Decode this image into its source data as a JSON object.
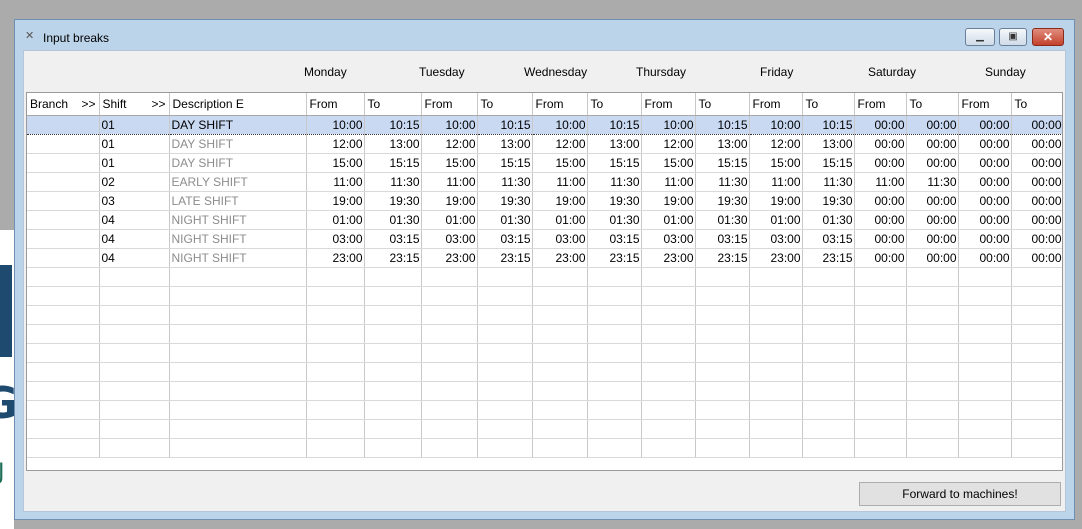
{
  "window": {
    "title": "Input breaks"
  },
  "days": [
    "Monday",
    "Tuesday",
    "Wednesday",
    "Thursday",
    "Friday",
    "Saturday",
    "Sunday"
  ],
  "columns": {
    "branch": "Branch",
    "branch_arrow": ">>",
    "shift": "Shift",
    "shift_arrow": ">>",
    "description": "Description E",
    "from": "From",
    "to": "To"
  },
  "rows": [
    {
      "branch": "",
      "shift": "01",
      "description": "DAY SHIFT",
      "times": [
        "10:00",
        "10:15",
        "10:00",
        "10:15",
        "10:00",
        "10:15",
        "10:00",
        "10:15",
        "10:00",
        "10:15",
        "00:00",
        "00:00",
        "00:00",
        "00:00"
      ]
    },
    {
      "branch": "",
      "shift": "01",
      "description": "DAY SHIFT",
      "times": [
        "12:00",
        "13:00",
        "12:00",
        "13:00",
        "12:00",
        "13:00",
        "12:00",
        "13:00",
        "12:00",
        "13:00",
        "00:00",
        "00:00",
        "00:00",
        "00:00"
      ]
    },
    {
      "branch": "",
      "shift": "01",
      "description": "DAY SHIFT",
      "times": [
        "15:00",
        "15:15",
        "15:00",
        "15:15",
        "15:00",
        "15:15",
        "15:00",
        "15:15",
        "15:00",
        "15:15",
        "00:00",
        "00:00",
        "00:00",
        "00:00"
      ]
    },
    {
      "branch": "",
      "shift": "02",
      "description": "EARLY SHIFT",
      "times": [
        "11:00",
        "11:30",
        "11:00",
        "11:30",
        "11:00",
        "11:30",
        "11:00",
        "11:30",
        "11:00",
        "11:30",
        "11:00",
        "11:30",
        "00:00",
        "00:00"
      ]
    },
    {
      "branch": "",
      "shift": "03",
      "description": "LATE SHIFT",
      "times": [
        "19:00",
        "19:30",
        "19:00",
        "19:30",
        "19:00",
        "19:30",
        "19:00",
        "19:30",
        "19:00",
        "19:30",
        "00:00",
        "00:00",
        "00:00",
        "00:00"
      ]
    },
    {
      "branch": "",
      "shift": "04",
      "description": "NIGHT SHIFT",
      "times": [
        "01:00",
        "01:30",
        "01:00",
        "01:30",
        "01:00",
        "01:30",
        "01:00",
        "01:30",
        "01:00",
        "01:30",
        "00:00",
        "00:00",
        "00:00",
        "00:00"
      ]
    },
    {
      "branch": "",
      "shift": "04",
      "description": "NIGHT SHIFT",
      "times": [
        "03:00",
        "03:15",
        "03:00",
        "03:15",
        "03:00",
        "03:15",
        "03:00",
        "03:15",
        "03:00",
        "03:15",
        "00:00",
        "00:00",
        "00:00",
        "00:00"
      ]
    },
    {
      "branch": "",
      "shift": "04",
      "description": "NIGHT SHIFT",
      "times": [
        "23:00",
        "23:15",
        "23:00",
        "23:15",
        "23:00",
        "23:15",
        "23:00",
        "23:15",
        "23:00",
        "23:15",
        "00:00",
        "00:00",
        "00:00",
        "00:00"
      ]
    }
  ],
  "selected_row": 0,
  "forward_button": "Forward to machines!",
  "colors": {
    "selected_row": "#c9d9f2",
    "description_gray": "#8c8c8c",
    "close_button": "#c4412c"
  }
}
